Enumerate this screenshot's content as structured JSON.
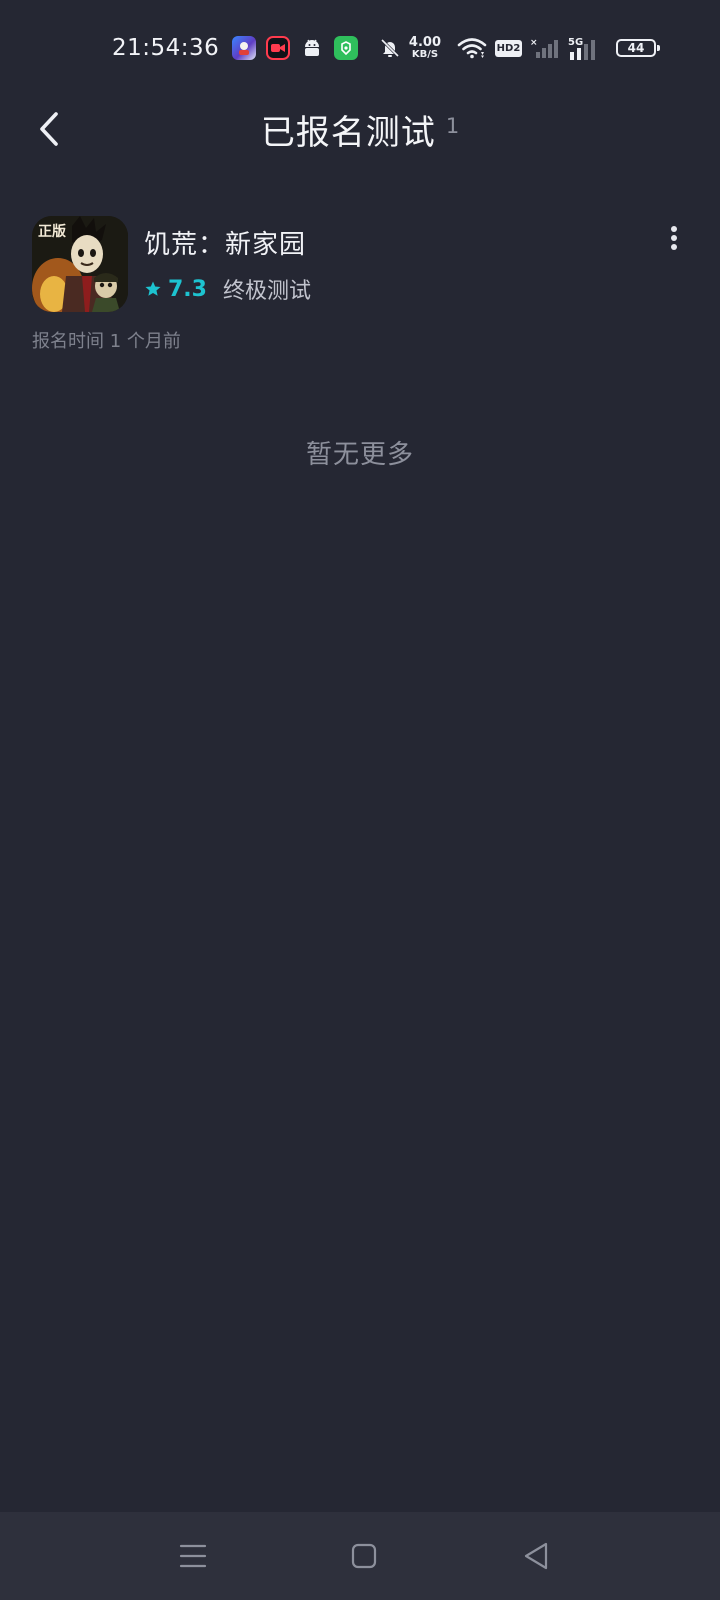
{
  "status_bar": {
    "time": "21:54:36",
    "net_speed_value": "4.00",
    "net_speed_unit": "KB/S",
    "hd_label": "HD2",
    "network_type": "5G",
    "battery_level": "44",
    "app_icons": [
      "game-app-icon",
      "screen-recorder-icon",
      "android-icon",
      "green-app-icon"
    ],
    "system_icons": [
      "bell-off-icon",
      "wifi-icon",
      "hd-icon",
      "signal-icon",
      "5g-signal-icon",
      "battery-icon"
    ]
  },
  "header": {
    "title": "已报名测试",
    "count": "1",
    "back_icon": "chevron-left-icon"
  },
  "games": [
    {
      "name": "饥荒：新家园",
      "icon_badge": "正版",
      "rating": "7.3",
      "test_type": "终极测试",
      "signup_time": "报名时间 1 个月前",
      "rating_color": "#1dc3d0"
    }
  ],
  "list_footer": "暂无更多",
  "nav_bar": {
    "items": [
      "menu-icon",
      "home-square-icon",
      "back-triangle-icon"
    ]
  },
  "colors": {
    "background": "#252733",
    "nav_background": "#2e303c",
    "accent": "#1dc3d0",
    "primary_text": "#f1f2f6",
    "secondary_text": "#7e818d"
  }
}
